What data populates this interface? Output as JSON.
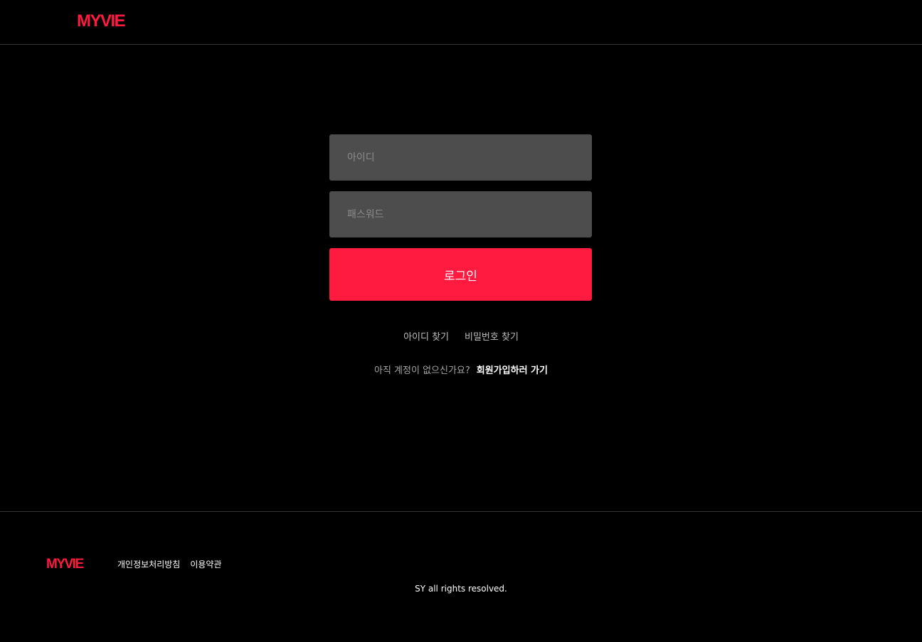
{
  "header": {
    "logo": "MYVIE"
  },
  "login": {
    "id_placeholder": "아이디",
    "password_placeholder": "패스워드",
    "submit_label": "로그인"
  },
  "links": {
    "find_id": "아이디 찾기",
    "find_password": "비밀번호 찾기"
  },
  "signup": {
    "prompt": "아직 계정이 없으신가요?",
    "link": "회원가입하러 가기"
  },
  "footer": {
    "logo": "MYVIE",
    "privacy": "개인정보처리방침",
    "terms": "이용약관",
    "copyright": "SY all rights resolved."
  },
  "colors": {
    "brand": "#ff1a40",
    "background": "#000000",
    "input": "#4d4d4d"
  }
}
